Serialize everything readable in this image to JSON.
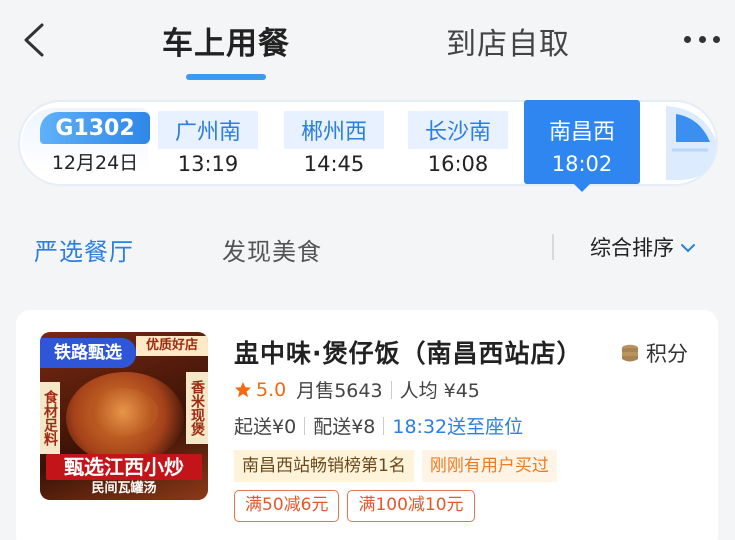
{
  "header": {
    "tab_active": "车上用餐",
    "tab_other": "到店自取"
  },
  "train": {
    "number": "G1302",
    "date": "12月24日",
    "stations": [
      {
        "name": "广州南",
        "time": "13:19"
      },
      {
        "name": "郴州西",
        "time": "14:45"
      },
      {
        "name": "长沙南",
        "time": "16:08"
      },
      {
        "name": "南昌西",
        "time": "18:02",
        "selected": true
      }
    ]
  },
  "subtabs": {
    "active": "严选餐厅",
    "other": "发现美食",
    "sort": "综合排序"
  },
  "restaurant": {
    "name": "盅中味·煲仔饭（南昌西站店）",
    "points": "积分",
    "rating": "5.0",
    "monthly_sales": "月售5643",
    "avg_price": "人均 ¥45",
    "min_order": "起送¥0",
    "delivery_fee": "配送¥8",
    "eta": "18:32送至座位",
    "highlights": [
      "南昌西站畅销榜第1名",
      "刚刚有用户买过"
    ],
    "coupons": [
      "满50减6元",
      "满100减10元"
    ],
    "thumb": {
      "badge": "铁路甄选",
      "top_label": "优质好店",
      "left_tag": "食材足料",
      "right_tag": "香米现煲",
      "banner": "甄选江西小炒",
      "banner_sub": "民间瓦罐汤"
    }
  },
  "colors": {
    "accent": "#2f86f0",
    "rating": "#f26b10",
    "coupon": "#e5572a"
  }
}
